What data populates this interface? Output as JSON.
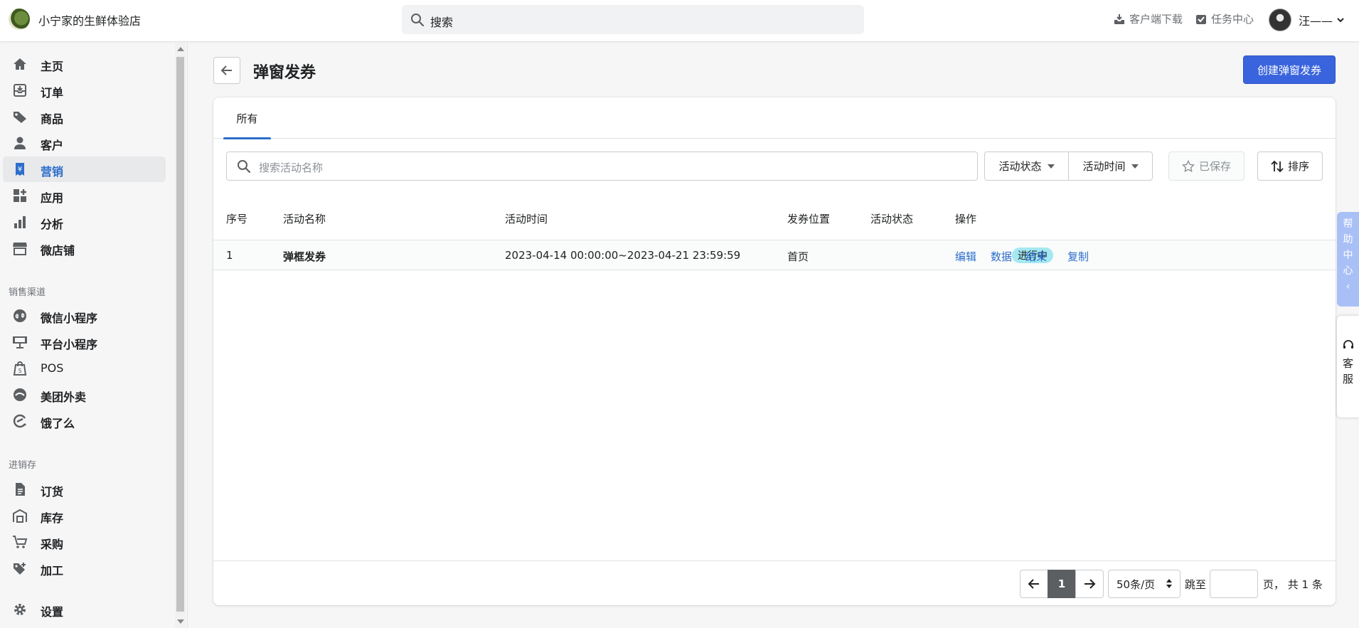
{
  "store": {
    "name": "小宁家的生鲜体验店"
  },
  "search": {
    "placeholder": "搜索"
  },
  "top_links": {
    "download": "客户端下载",
    "tasks": "任务中心",
    "user": "汪——"
  },
  "sidebar": {
    "main": [
      {
        "label": "主页",
        "icon": "home-icon"
      },
      {
        "label": "订单",
        "icon": "order-icon"
      },
      {
        "label": "商品",
        "icon": "tag-icon"
      },
      {
        "label": "客户",
        "icon": "customer-icon"
      },
      {
        "label": "营销",
        "icon": "marketing-icon",
        "active": true
      },
      {
        "label": "应用",
        "icon": "apps-icon"
      },
      {
        "label": "分析",
        "icon": "analytics-icon"
      },
      {
        "label": "微店铺",
        "icon": "store-icon"
      }
    ],
    "sales_title": "销售渠道",
    "sales": [
      {
        "label": "微信小程序",
        "icon": "wechat-miniprogram-icon"
      },
      {
        "label": "平台小程序",
        "icon": "platform-miniprogram-icon"
      },
      {
        "label": "POS",
        "icon": "pos-icon"
      },
      {
        "label": "美团外卖",
        "icon": "meituan-icon"
      },
      {
        "label": "饿了么",
        "icon": "eleme-icon"
      }
    ],
    "inventory_title": "进销存",
    "inventory": [
      {
        "label": "订货",
        "icon": "document-icon"
      },
      {
        "label": "库存",
        "icon": "warehouse-icon"
      },
      {
        "label": "采购",
        "icon": "purchase-icon"
      },
      {
        "label": "加工",
        "icon": "process-icon"
      }
    ],
    "settings": {
      "label": "设置",
      "icon": "gear-icon"
    }
  },
  "page": {
    "title": "弹窗发券",
    "create_button": "创建弹窗发券"
  },
  "tabs": [
    "所有"
  ],
  "filters": {
    "search_placeholder": "搜索活动名称",
    "status": "活动状态",
    "time": "活动时间",
    "saved": "已保存",
    "sort": "排序"
  },
  "table": {
    "headers": [
      "序号",
      "活动名称",
      "活动时间",
      "发券位置",
      "活动状态",
      "操作"
    ],
    "rows": [
      {
        "index": "1",
        "name": "弹框发券",
        "time": "2023-04-14 00:00:00~2023-04-21 23:59:59",
        "position": "首页",
        "status": "进行中",
        "actions": [
          "编辑",
          "数据",
          "结束",
          "复制"
        ]
      }
    ]
  },
  "pagination": {
    "current": "1",
    "per_page": "50条/页",
    "jump_label": "跳至",
    "total": "页， 共 1 条"
  },
  "floating": {
    "help": [
      "帮",
      "助",
      "中",
      "心",
      "‹"
    ],
    "service": [
      "客",
      "服"
    ]
  },
  "colors": {
    "accent": "#2c6ecb",
    "primary": "#3a64dd",
    "badge": "#a4e8f2"
  }
}
